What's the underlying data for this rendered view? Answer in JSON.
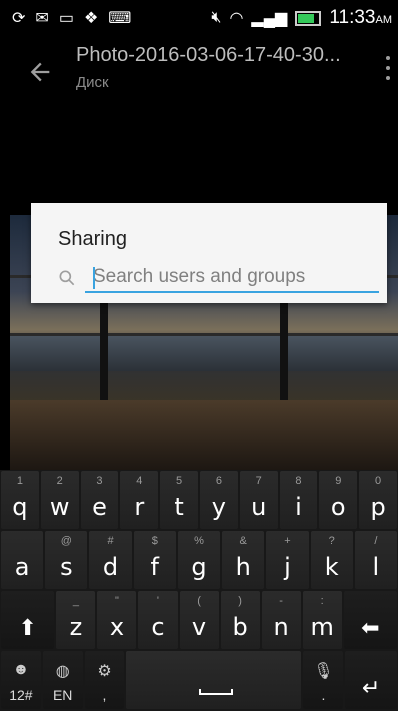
{
  "status_bar": {
    "time": "11:33",
    "ampm": "AM",
    "icons": [
      "sync-icon",
      "gmail-icon",
      "screen-icon",
      "dropbox-icon",
      "keyboard-icon",
      "mute-icon",
      "wifi-icon",
      "signal-icon",
      "battery-icon"
    ]
  },
  "app_bar": {
    "title": "Photo-2016-03-06-17-40-30...",
    "subtitle": "Диск"
  },
  "dialog": {
    "title": "Sharing",
    "search_placeholder": "Search users and groups",
    "search_value": ""
  },
  "keyboard": {
    "row1": [
      {
        "main": "q",
        "hint": "1"
      },
      {
        "main": "w",
        "hint": "2"
      },
      {
        "main": "e",
        "hint": "3"
      },
      {
        "main": "r",
        "hint": "4"
      },
      {
        "main": "t",
        "hint": "5"
      },
      {
        "main": "y",
        "hint": "6"
      },
      {
        "main": "u",
        "hint": "7"
      },
      {
        "main": "i",
        "hint": "8"
      },
      {
        "main": "o",
        "hint": "9"
      },
      {
        "main": "p",
        "hint": "0"
      }
    ],
    "row2": [
      {
        "main": "a",
        "hint": ""
      },
      {
        "main": "s",
        "hint": "@"
      },
      {
        "main": "d",
        "hint": "#"
      },
      {
        "main": "f",
        "hint": "$"
      },
      {
        "main": "g",
        "hint": "%"
      },
      {
        "main": "h",
        "hint": "&"
      },
      {
        "main": "j",
        "hint": "+"
      },
      {
        "main": "k",
        "hint": "?"
      },
      {
        "main": "l",
        "hint": "/"
      }
    ],
    "row3": [
      {
        "main": "z",
        "hint": "_"
      },
      {
        "main": "x",
        "hint": "\""
      },
      {
        "main": "c",
        "hint": "'"
      },
      {
        "main": "v",
        "hint": "("
      },
      {
        "main": "b",
        "hint": ")"
      },
      {
        "main": "n",
        "hint": "-"
      },
      {
        "main": "m",
        "hint": ":"
      }
    ],
    "symbols_key": "12#",
    "language_key": "EN",
    "comma_key": ",",
    "period_key": "."
  }
}
